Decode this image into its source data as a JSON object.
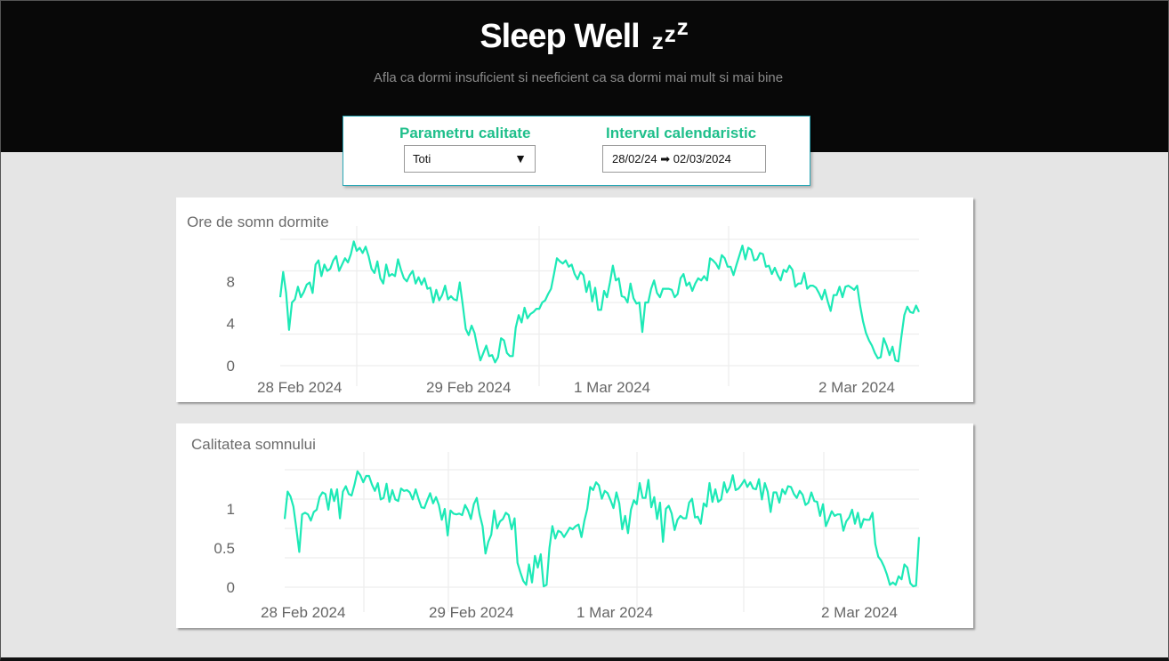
{
  "header": {
    "title": "Sleep Well",
    "zzz": [
      "z",
      "z",
      "z"
    ],
    "subtitle": "Afla ca dormi insuficient si neeficient ca sa dormi mai mult si mai bine"
  },
  "controls": {
    "quality_label": "Parametru calitate",
    "quality_selected": "Toti",
    "quality_arrow": "▼",
    "interval_label": "Interval calendaristic",
    "interval_start": "28/02/24",
    "interval_arrow": "➡",
    "interval_end": "02/03/2024"
  },
  "colors": {
    "accent": "#1fbf8b",
    "line": "#1de9b6",
    "header_bg": "#080808",
    "page_bg": "#e5e5e5"
  },
  "chart_data": [
    {
      "type": "line",
      "title": "Ore de somn dormite",
      "xlabel": "",
      "ylabel": "",
      "x_ticks": [
        "28 Feb 2024",
        "29 Feb 2024",
        "1 Mar 2024",
        "2 Mar 2024"
      ],
      "x_range": [
        "2024-02-28 00:00",
        "2024-03-02 12:00"
      ],
      "y_ticks": [
        0,
        4,
        8
      ],
      "ylim": [
        0,
        12
      ],
      "grid": true,
      "series": [
        {
          "values": [
            6.5,
            8.9,
            6.9,
            3.4,
            6.0,
            6.3,
            7.5,
            6.5,
            7.0,
            7.7,
            7.9,
            6.9,
            9.6,
            10.0,
            8.5,
            9.6,
            9.0,
            9.2,
            10.0,
            10.4,
            9.0,
            9.6,
            10.2,
            9.8,
            10.6,
            11.8,
            10.9,
            11.2,
            10.7,
            11.3,
            10.4,
            9.2,
            8.8,
            9.9,
            8.3,
            7.8,
            9.6,
            8.5,
            8.7,
            8.5,
            10.1,
            9.1,
            8.3,
            8.0,
            8.6,
            9.0,
            7.8,
            8.4,
            7.7,
            8.3,
            7.3,
            7.4,
            6.0,
            7.2,
            6.2,
            6.7,
            7.6,
            6.3,
            6.6,
            6.3,
            6.2,
            7.9,
            5.8,
            3.5,
            2.9,
            3.8,
            3.1,
            1.7,
            0.5,
            1.2,
            1.9,
            0.9,
            1.0,
            0.3,
            0.8,
            2.6,
            2.4,
            1.2,
            0.9,
            0.9,
            3.6,
            4.8,
            4.1,
            5.5,
            4.5,
            4.9,
            5.1,
            5.4,
            5.4,
            6.0,
            6.2,
            6.8,
            7.3,
            8.7,
            10.2,
            9.9,
            9.7,
            10.0,
            9.4,
            9.6,
            8.7,
            8.2,
            8.9,
            8.6,
            7.0,
            8.0,
            6.1,
            7.4,
            5.3,
            5.3,
            7.1,
            6.5,
            7.9,
            9.5,
            8.1,
            8.3,
            6.6,
            6.5,
            6.0,
            7.8,
            6.4,
            5.9,
            6.0,
            3.2,
            6.0,
            6.0,
            7.3,
            8.1,
            6.9,
            6.5,
            7.3,
            7.3,
            7.3,
            7.2,
            6.5,
            6.8,
            8.3,
            8.7,
            7.6,
            7.9,
            7.1,
            7.8,
            8.3,
            8.1,
            8.5,
            8.1,
            10.2,
            10.0,
            9.7,
            9.2,
            10.5,
            10.2,
            9.4,
            9.4,
            8.6,
            9.6,
            10.5,
            11.4,
            10.1,
            11.2,
            11.0,
            10.0,
            10.1,
            10.7,
            10.6,
            9.4,
            9.5,
            8.7,
            9.3,
            8.6,
            8.1,
            9.1,
            8.9,
            9.5,
            9.1,
            7.5,
            7.8,
            7.8,
            8.8,
            7.3,
            7.6,
            7.6,
            7.4,
            6.9,
            6.3,
            7.2,
            6.1,
            5.2,
            6.7,
            6.7,
            7.5,
            6.5,
            7.5,
            7.6,
            7.4,
            7.2,
            7.6,
            5.7,
            4.2,
            3.1,
            2.4,
            1.9,
            1.2,
            0.7,
            0.8,
            2.6,
            1.9,
            1.0,
            1.8,
            0.5,
            0.4,
            2.7,
            4.8,
            5.6,
            5.1,
            5.0,
            5.7,
            5.1
          ]
        }
      ]
    },
    {
      "type": "line",
      "title": "Calitatea somnului",
      "xlabel": "",
      "ylabel": "",
      "x_ticks": [
        "28 Feb 2024",
        "29 Feb 2024",
        "1 Mar 2024",
        "2 Mar 2024"
      ],
      "x_range": [
        "2024-02-28 00:00",
        "2024-03-02 12:00"
      ],
      "y_ticks": [
        0,
        0.5,
        1
      ],
      "ylim": [
        0,
        1.5
      ],
      "grid": true,
      "series": [
        {
          "values": [
            0.87,
            1.22,
            1.16,
            1.03,
            0.75,
            0.45,
            0.93,
            0.95,
            0.93,
            0.85,
            0.96,
            0.99,
            1.15,
            1.21,
            1.19,
            0.99,
            1.25,
            1.1,
            1.25,
            0.88,
            1.22,
            1.29,
            1.19,
            1.17,
            1.31,
            1.48,
            1.43,
            1.34,
            1.42,
            1.42,
            1.31,
            1.23,
            1.33,
            1.12,
            1.14,
            1.32,
            1.09,
            1.24,
            1.12,
            1.1,
            1.26,
            1.23,
            1.24,
            1.21,
            1.12,
            1.25,
            1.13,
            1.02,
            1.01,
            1.11,
            1.2,
            1.07,
            1.15,
            1.05,
            0.86,
            1.0,
            0.66,
            0.98,
            0.94,
            0.93,
            0.94,
            0.92,
            1.05,
            0.98,
            0.87,
            1.06,
            1.14,
            0.93,
            0.78,
            0.43,
            0.58,
            0.67,
            0.98,
            0.75,
            0.84,
            0.87,
            0.95,
            0.92,
            0.74,
            0.88,
            0.31,
            0.19,
            0.08,
            0.03,
            0.29,
            0.06,
            0.4,
            0.25,
            0.42,
            0.01,
            0.03,
            0.5,
            0.78,
            0.62,
            0.72,
            0.7,
            0.64,
            0.7,
            0.76,
            0.74,
            0.78,
            0.8,
            0.64,
            0.85,
            1.0,
            1.28,
            1.24,
            1.34,
            1.3,
            1.13,
            1.23,
            1.2,
            1.11,
            1.01,
            1.21,
            1.07,
            0.74,
            0.91,
            0.69,
            0.99,
            1.11,
            1.06,
            1.33,
            1.14,
            1.14,
            1.37,
            1.02,
            1.15,
            0.87,
            1.08,
            0.58,
            1.0,
            1.04,
            0.94,
            0.73,
            0.86,
            0.91,
            0.88,
            0.88,
            1.08,
            1.13,
            0.89,
            0.9,
            0.81,
            1.07,
            1.03,
            1.33,
            1.09,
            1.25,
            1.09,
            1.12,
            1.34,
            1.21,
            1.28,
            1.43,
            1.24,
            1.26,
            1.31,
            1.37,
            1.28,
            1.34,
            1.26,
            1.25,
            1.38,
            1.12,
            1.33,
            1.22,
            0.96,
            1.21,
            1.21,
            1.08,
            1.25,
            1.19,
            1.29,
            1.28,
            1.19,
            1.14,
            1.23,
            1.18,
            1.05,
            1.08,
            1.21,
            1.1,
            1.09,
            0.91,
            1.06,
            0.78,
            0.87,
            0.97,
            0.91,
            0.93,
            0.93,
            0.72,
            0.84,
            0.89,
            0.99,
            0.81,
            0.95,
            0.76,
            0.87,
            0.86,
            0.86,
            0.95,
            0.55,
            0.39,
            0.34,
            0.26,
            0.16,
            0.03,
            0.06,
            0.03,
            0.14,
            0.1,
            0.29,
            0.25,
            0.05,
            0.01,
            0.02,
            0.64
          ]
        }
      ]
    }
  ]
}
